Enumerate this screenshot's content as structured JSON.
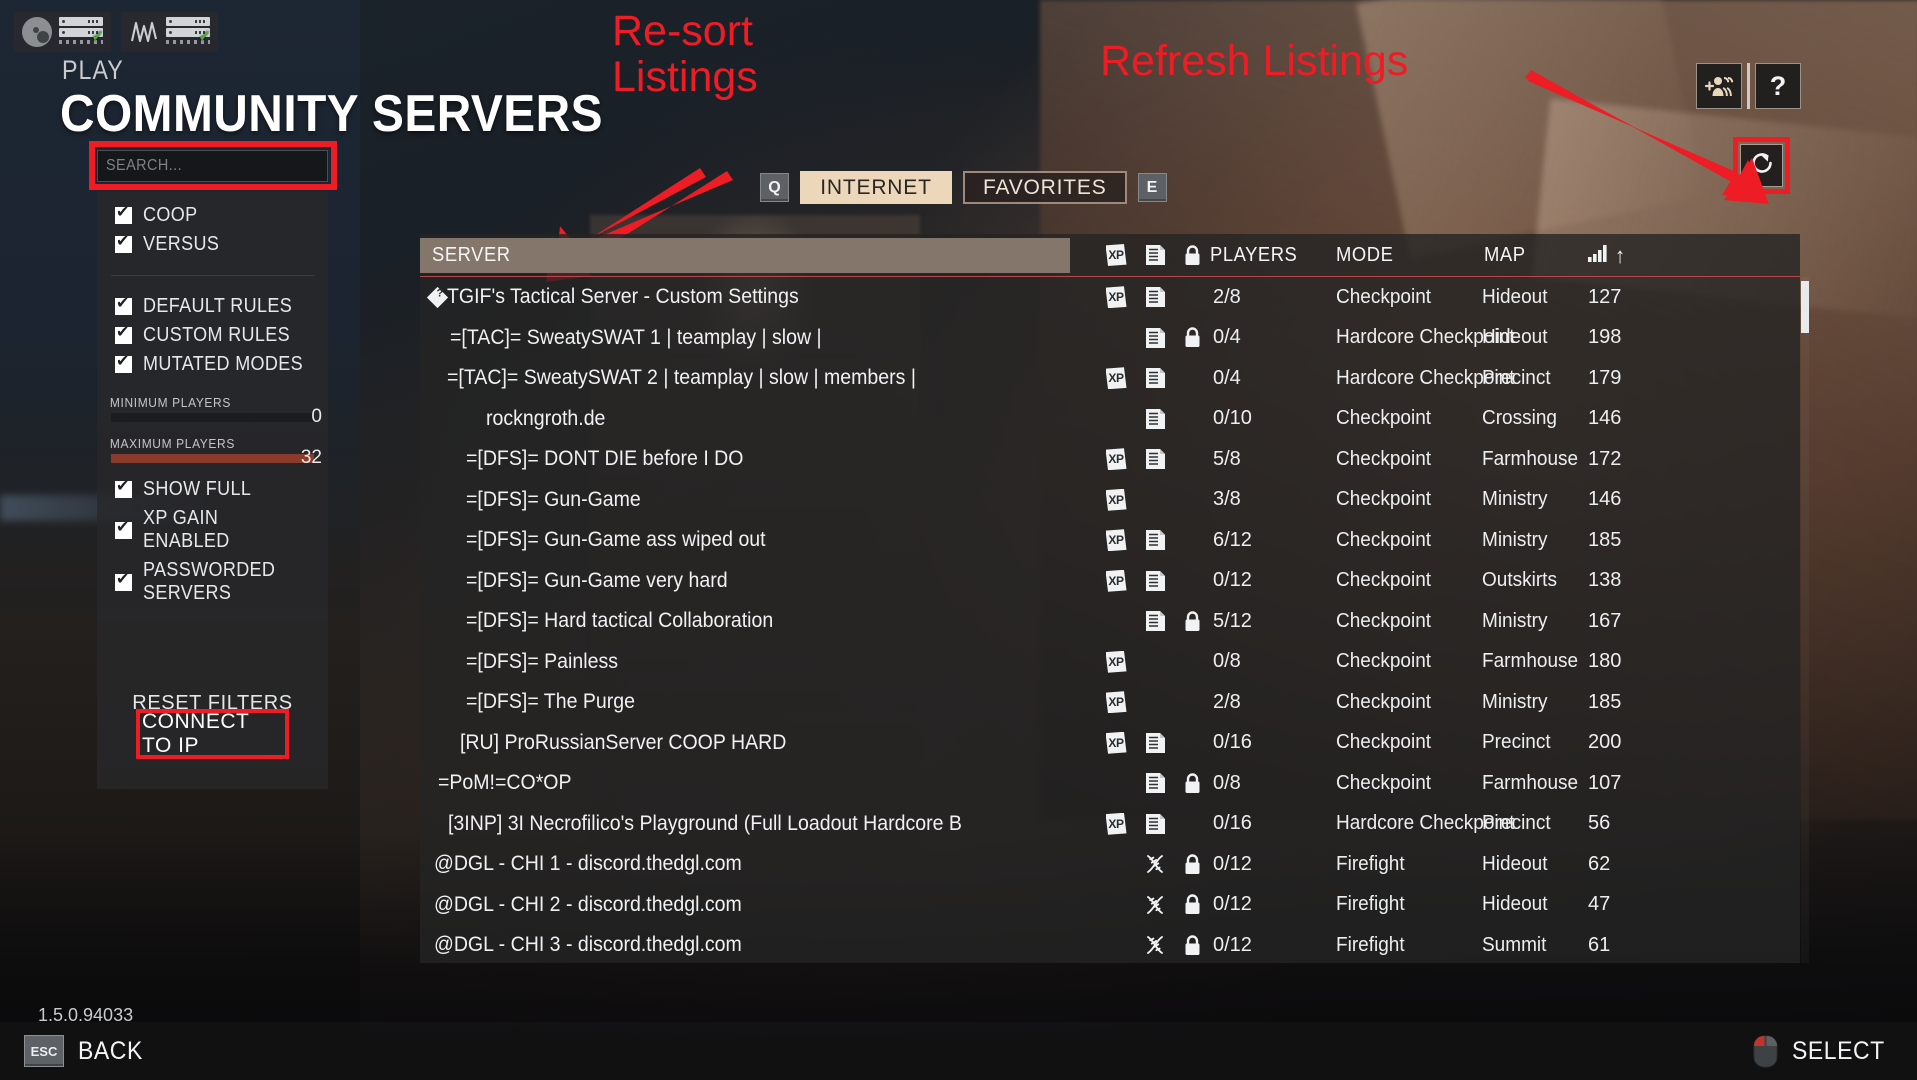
{
  "window": {
    "version": "1.5.0.94033"
  },
  "header": {
    "breadcrumb": "PLAY",
    "title": "COMMUNITY SERVERS"
  },
  "status_icons": {
    "steam_label": "steam-server-connected",
    "net_label": "network-server-connected"
  },
  "search": {
    "placeholder": "SEARCH...",
    "value": ""
  },
  "filters": {
    "mode_checks": [
      {
        "label": "COOP",
        "checked": true
      },
      {
        "label": "VERSUS",
        "checked": true
      }
    ],
    "rule_checks": [
      {
        "label": "DEFAULT RULES",
        "checked": true
      },
      {
        "label": "CUSTOM RULES",
        "checked": true
      },
      {
        "label": "MUTATED MODES",
        "checked": true
      }
    ],
    "min_players": {
      "label": "MINIMUM PLAYERS",
      "value": "0",
      "fill_percent": 0
    },
    "max_players": {
      "label": "MAXIMUM PLAYERS",
      "value": "32",
      "fill_percent": 100
    },
    "extra_checks": [
      {
        "label": "SHOW FULL",
        "checked": true
      },
      {
        "label": "XP GAIN ENABLED",
        "checked": true
      },
      {
        "label": "PASSWORDED SERVERS",
        "checked": true
      }
    ],
    "reset_label": "RESET FILTERS",
    "connect_label": "CONNECT TO IP"
  },
  "tabs": {
    "prev_key": "Q",
    "next_key": "E",
    "items": [
      {
        "label": "INTERNET",
        "active": true
      },
      {
        "label": "FAVORITES",
        "active": false
      }
    ]
  },
  "toolbar": {
    "add_friend_label": "+",
    "help_label": "?",
    "refresh_label": "refresh"
  },
  "annotations": [
    {
      "id": "resort",
      "text": "Re-sort\nListings",
      "color": "#ee1c25"
    },
    {
      "id": "refresh",
      "text": "Refresh Listings",
      "color": "#ee1c25"
    }
  ],
  "table": {
    "columns": {
      "server": "SERVER",
      "xp": "xp-icon",
      "rules": "rules-icon",
      "lock": "lock-icon",
      "players": "PLAYERS",
      "mode": "MODE",
      "map": "MAP",
      "ping": "signal-icon",
      "sort_arrow": "↑"
    },
    "rows": [
      {
        "name": "TGIF's Tactical Server - Custom Settings",
        "indent": 0,
        "badge": "diamond",
        "xp": true,
        "rules": "doc",
        "locked": false,
        "players": "2/8",
        "mode": "Checkpoint",
        "map": "Hideout",
        "ping": "127"
      },
      {
        "name": "=[TAC]= SweatySWAT 1 | teamplay | slow |",
        "indent": 20,
        "badge": "",
        "xp": false,
        "rules": "doc",
        "locked": true,
        "players": "0/4",
        "mode": "Hardcore Checkpoint",
        "map": "Hideout",
        "ping": "198"
      },
      {
        "name": "=[TAC]= SweatySWAT 2 | teamplay | slow | members |",
        "indent": 17,
        "badge": "",
        "xp": true,
        "rules": "doc",
        "locked": false,
        "players": "0/4",
        "mode": "Hardcore Checkpoint",
        "map": "Precinct",
        "ping": "179"
      },
      {
        "name": "rockngroth.de",
        "indent": 56,
        "badge": "",
        "xp": false,
        "rules": "doc",
        "locked": false,
        "players": "0/10",
        "mode": "Checkpoint",
        "map": "Crossing",
        "ping": "146"
      },
      {
        "name": "=[DFS]= DONT DIE before I DO",
        "indent": 36,
        "badge": "",
        "xp": true,
        "rules": "doc",
        "locked": false,
        "players": "5/8",
        "mode": "Checkpoint",
        "map": "Farmhouse",
        "ping": "172"
      },
      {
        "name": "=[DFS]= Gun-Game",
        "indent": 36,
        "badge": "",
        "xp": true,
        "rules": "",
        "locked": false,
        "players": "3/8",
        "mode": "Checkpoint",
        "map": "Ministry",
        "ping": "146"
      },
      {
        "name": "=[DFS]= Gun-Game ass wiped out",
        "indent": 36,
        "badge": "",
        "xp": true,
        "rules": "doc",
        "locked": false,
        "players": "6/12",
        "mode": "Checkpoint",
        "map": "Ministry",
        "ping": "185"
      },
      {
        "name": "=[DFS]= Gun-Game very hard",
        "indent": 36,
        "badge": "",
        "xp": true,
        "rules": "doc",
        "locked": false,
        "players": "0/12",
        "mode": "Checkpoint",
        "map": "Outskirts",
        "ping": "138"
      },
      {
        "name": "=[DFS]= Hard tactical Collaboration",
        "indent": 36,
        "badge": "",
        "xp": false,
        "rules": "doc",
        "locked": true,
        "players": "5/12",
        "mode": "Checkpoint",
        "map": "Ministry",
        "ping": "167"
      },
      {
        "name": "=[DFS]= Painless",
        "indent": 36,
        "badge": "",
        "xp": true,
        "rules": "",
        "locked": false,
        "players": "0/8",
        "mode": "Checkpoint",
        "map": "Farmhouse",
        "ping": "180"
      },
      {
        "name": "=[DFS]= The Purge",
        "indent": 36,
        "badge": "",
        "xp": true,
        "rules": "",
        "locked": false,
        "players": "2/8",
        "mode": "Checkpoint",
        "map": "Ministry",
        "ping": "185"
      },
      {
        "name": "[RU] ProRussianServer COOP HARD",
        "indent": 30,
        "badge": "",
        "xp": true,
        "rules": "doc",
        "locked": false,
        "players": "0/16",
        "mode": "Checkpoint",
        "map": "Precinct",
        "ping": "200"
      },
      {
        "name": "=PoM!=CO*OP",
        "indent": 8,
        "badge": "",
        "xp": false,
        "rules": "doc",
        "locked": true,
        "players": "0/8",
        "mode": "Checkpoint",
        "map": "Farmhouse",
        "ping": "107"
      },
      {
        "name": "[3INP] 3I Necrofilico's Playground (Full Loadout Hardcore B",
        "indent": 18,
        "badge": "",
        "xp": true,
        "rules": "doc",
        "locked": false,
        "players": "0/16",
        "mode": "Hardcore Checkpoint",
        "map": "Precinct",
        "ping": "56"
      },
      {
        "name": "@DGL - CHI 1 - discord.thedgl.com",
        "indent": 4,
        "badge": "",
        "xp": false,
        "rules": "dna",
        "locked": true,
        "players": "0/12",
        "mode": "Firefight",
        "map": "Hideout",
        "ping": "62"
      },
      {
        "name": "@DGL - CHI 2 - discord.thedgl.com",
        "indent": 4,
        "badge": "",
        "xp": false,
        "rules": "dna",
        "locked": true,
        "players": "0/12",
        "mode": "Firefight",
        "map": "Hideout",
        "ping": "47"
      },
      {
        "name": "@DGL - CHI 3 - discord.thedgl.com",
        "indent": 4,
        "badge": "",
        "xp": false,
        "rules": "dna",
        "locked": true,
        "players": "0/12",
        "mode": "Firefight",
        "map": "Summit",
        "ping": "61"
      }
    ]
  },
  "footer": {
    "back_key": "ESC",
    "back_label": "BACK",
    "select_label": "SELECT",
    "select_icon": "mouse-left-click-icon"
  },
  "colors": {
    "accent_red": "#ee1c25",
    "tab_active_bg": "#edd7bb",
    "header_bar": "#85766c",
    "slider_fill": "#8a3b2b"
  }
}
